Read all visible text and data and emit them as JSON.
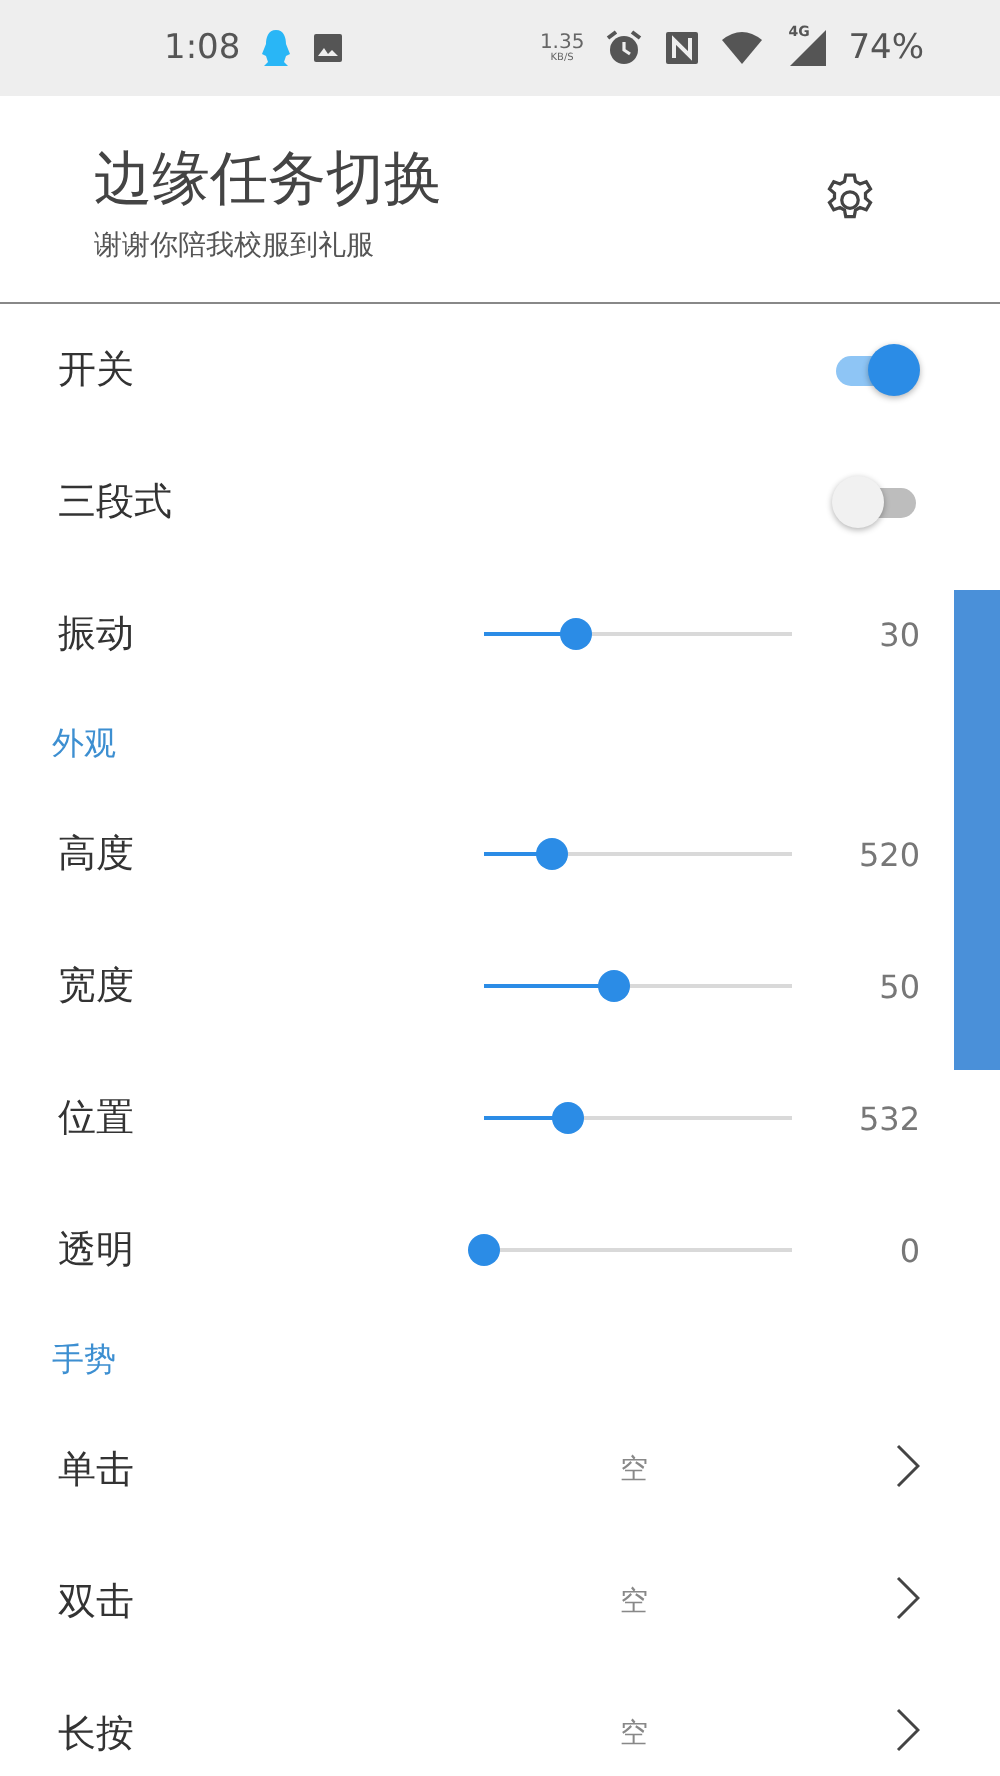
{
  "status_bar": {
    "time": "1:08",
    "speed_value": "1.35",
    "speed_unit": "KB/S",
    "network": "4G",
    "battery": "74%"
  },
  "header": {
    "title": "边缘任务切换",
    "subtitle": "谢谢你陪我校服到礼服"
  },
  "items": [
    {
      "kind": "switch",
      "label": "开关",
      "on": true
    },
    {
      "kind": "switch",
      "label": "三段式",
      "on": false
    },
    {
      "kind": "slider",
      "label": "振动",
      "level": 0.3,
      "reading": "30"
    },
    {
      "kind": "section",
      "label": "外观"
    },
    {
      "kind": "slider",
      "label": "高度",
      "level": 0.22,
      "reading": "520"
    },
    {
      "kind": "slider",
      "label": "宽度",
      "level": 0.42,
      "reading": "50"
    },
    {
      "kind": "slider",
      "label": "位置",
      "level": 0.27,
      "reading": "532"
    },
    {
      "kind": "slider",
      "label": "透明",
      "level": 0,
      "reading": "0"
    },
    {
      "kind": "section",
      "label": "手势"
    },
    {
      "kind": "nav",
      "label": "单击",
      "value": "空"
    },
    {
      "kind": "nav",
      "label": "双击",
      "value": "空"
    },
    {
      "kind": "nav",
      "label": "长按",
      "value": "空"
    }
  ]
}
